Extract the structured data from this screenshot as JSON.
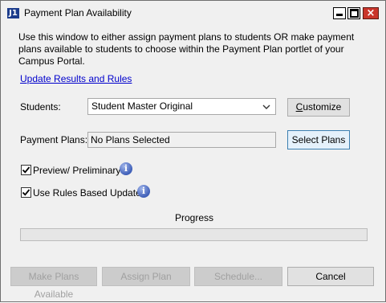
{
  "window": {
    "title": "Payment Plan Availability",
    "app_icon": "J1"
  },
  "description": "Use this window to either assign payment plans to students OR make payment plans available to students to choose within the Payment Plan portlet of your Campus Portal.",
  "update_link": "Update Results and Rules",
  "students": {
    "label": "Students:",
    "selected": "Student Master Original",
    "customize_prefix": "C",
    "customize_rest": "ustomize"
  },
  "payment_plans": {
    "label": "Payment Plans:",
    "value": "No Plans Selected",
    "select_button": "Select Plans"
  },
  "options": {
    "preview": {
      "label": "Preview/ Preliminary",
      "checked": true
    },
    "rules": {
      "label": "Use Rules Based Update",
      "checked": true
    }
  },
  "progress": {
    "label": "Progress",
    "value": 0
  },
  "buttons": {
    "make_available": "Make Plans Available",
    "assign": "Assign Plan",
    "schedule": "Schedule...",
    "cancel": "Cancel"
  },
  "icons": {
    "info": "info-icon",
    "dropdown": "chevron-down-icon"
  }
}
